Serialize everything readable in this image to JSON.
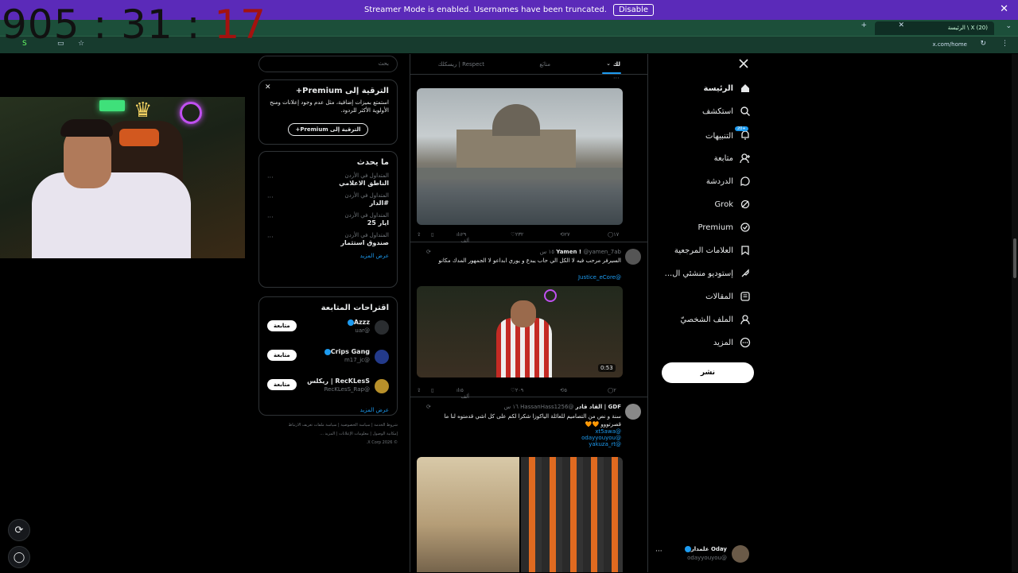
{
  "banner": {
    "message": "Streamer Mode is enabled. Usernames have been truncated.",
    "disable_label": "Disable",
    "close": "✕"
  },
  "browser": {
    "tab_title": "الرئيسة \\ X (20)",
    "url": "x.com/home"
  },
  "stream": {
    "timer_main": "905 : 31 : ",
    "timer_seconds": "17"
  },
  "search": {
    "placeholder": "بحث"
  },
  "premium": {
    "title": "الترقية إلى Premium+",
    "desc": "استمتع بميزات إضافية، مثل عدم وجود إعلانات ومنح الأولوية الأكثر للردود.",
    "button": "الترقية إلى Premium+"
  },
  "whats_happening": {
    "title": "ما يحدث",
    "trends": [
      {
        "context": "المتداول في الأردن",
        "topic": "الناطق الاعلامي"
      },
      {
        "context": "المتداول في الأردن",
        "topic": "#الدار"
      },
      {
        "context": "المتداول في الأردن",
        "topic": "ايار 25"
      },
      {
        "context": "المتداول في الأردن",
        "topic": "صندوق استثمار"
      }
    ],
    "more": "عرض المزيد"
  },
  "who_to_follow": {
    "title": "اقتراحات المتابعة",
    "users": [
      {
        "name": "Azzz",
        "handle": "@uar",
        "button": "متابعة",
        "color": "#2a2d30"
      },
      {
        "name": "Crips Gang",
        "handle": "@m17_jc",
        "button": "متابعة",
        "color": "#233a8a"
      },
      {
        "name": "RecKLesS | ريكلس",
        "handle": "@RecKLesS_Rap",
        "button": "متابعة",
        "color": "#b8902a"
      }
    ],
    "more": "عرض المزيد"
  },
  "footer": {
    "lines": [
      "شروط الخدمة | سياسة الخصوصية | سياسة ملفات تعريف الارتباط",
      "إمكانية الوصول | معلومات الإعلانات | المزيد ...",
      "© 2026 X Corp."
    ]
  },
  "feed": {
    "tabs": {
      "for_you": "لك",
      "following": "متابَع",
      "third": "ريسكلك | Respect"
    },
    "post1": {
      "views": "٢٩ ألف",
      "likes": "٢٣٢",
      "reposts": "٢٧",
      "replies": "١٧"
    },
    "post2": {
      "name": "Yamen !",
      "handle": "@yamen_7ab",
      "time": "١٥ س",
      "text": "السيرفر مرحب فيه لا الكل الي حاب يبدع و يوري ابداعو لا الجمهور المدك مكانو",
      "link": "@Justice_eCore",
      "duration": "0:53",
      "views": "٥ ألف",
      "likes": "٢٠٩",
      "reposts": "٥",
      "replies": "٢"
    },
    "post3": {
      "name": "GDF | القاد قادر",
      "handle": "@HassanHass1256",
      "time": "١٦ س",
      "text": "سنة و نص من التصاميم للعائلة الياكوزا شكرا لكم على كل اشي قدمتوه لنا ما قصرتووو 🧡🧡",
      "links": [
        "@xt5awa",
        "@odayyouyou",
        "@yakuza_rt"
      ]
    }
  },
  "nav": {
    "items": [
      {
        "label": "الرئيسة",
        "icon": "home-icon"
      },
      {
        "label": "استكشف",
        "icon": "search-icon"
      },
      {
        "label": "التنبيهات",
        "icon": "bell-icon",
        "badge": "+20"
      },
      {
        "label": "متابعة",
        "icon": "follow-icon"
      },
      {
        "label": "الدردشة",
        "icon": "chat-icon"
      },
      {
        "label": "Grok",
        "icon": "grok-icon"
      },
      {
        "label": "Premium",
        "icon": "premium-icon"
      },
      {
        "label": "العلامات المرجعية",
        "icon": "bookmark-icon"
      },
      {
        "label": "إستوديو منشئي ال...",
        "icon": "rocket-icon"
      },
      {
        "label": "المقالات",
        "icon": "article-icon"
      },
      {
        "label": "الملف الشخصيّ",
        "icon": "profile-icon"
      },
      {
        "label": "المزيد",
        "icon": "more-icon"
      }
    ],
    "post_button": "نشر"
  },
  "account": {
    "name": "Oday علمدار",
    "handle": "@odayyouyou"
  }
}
